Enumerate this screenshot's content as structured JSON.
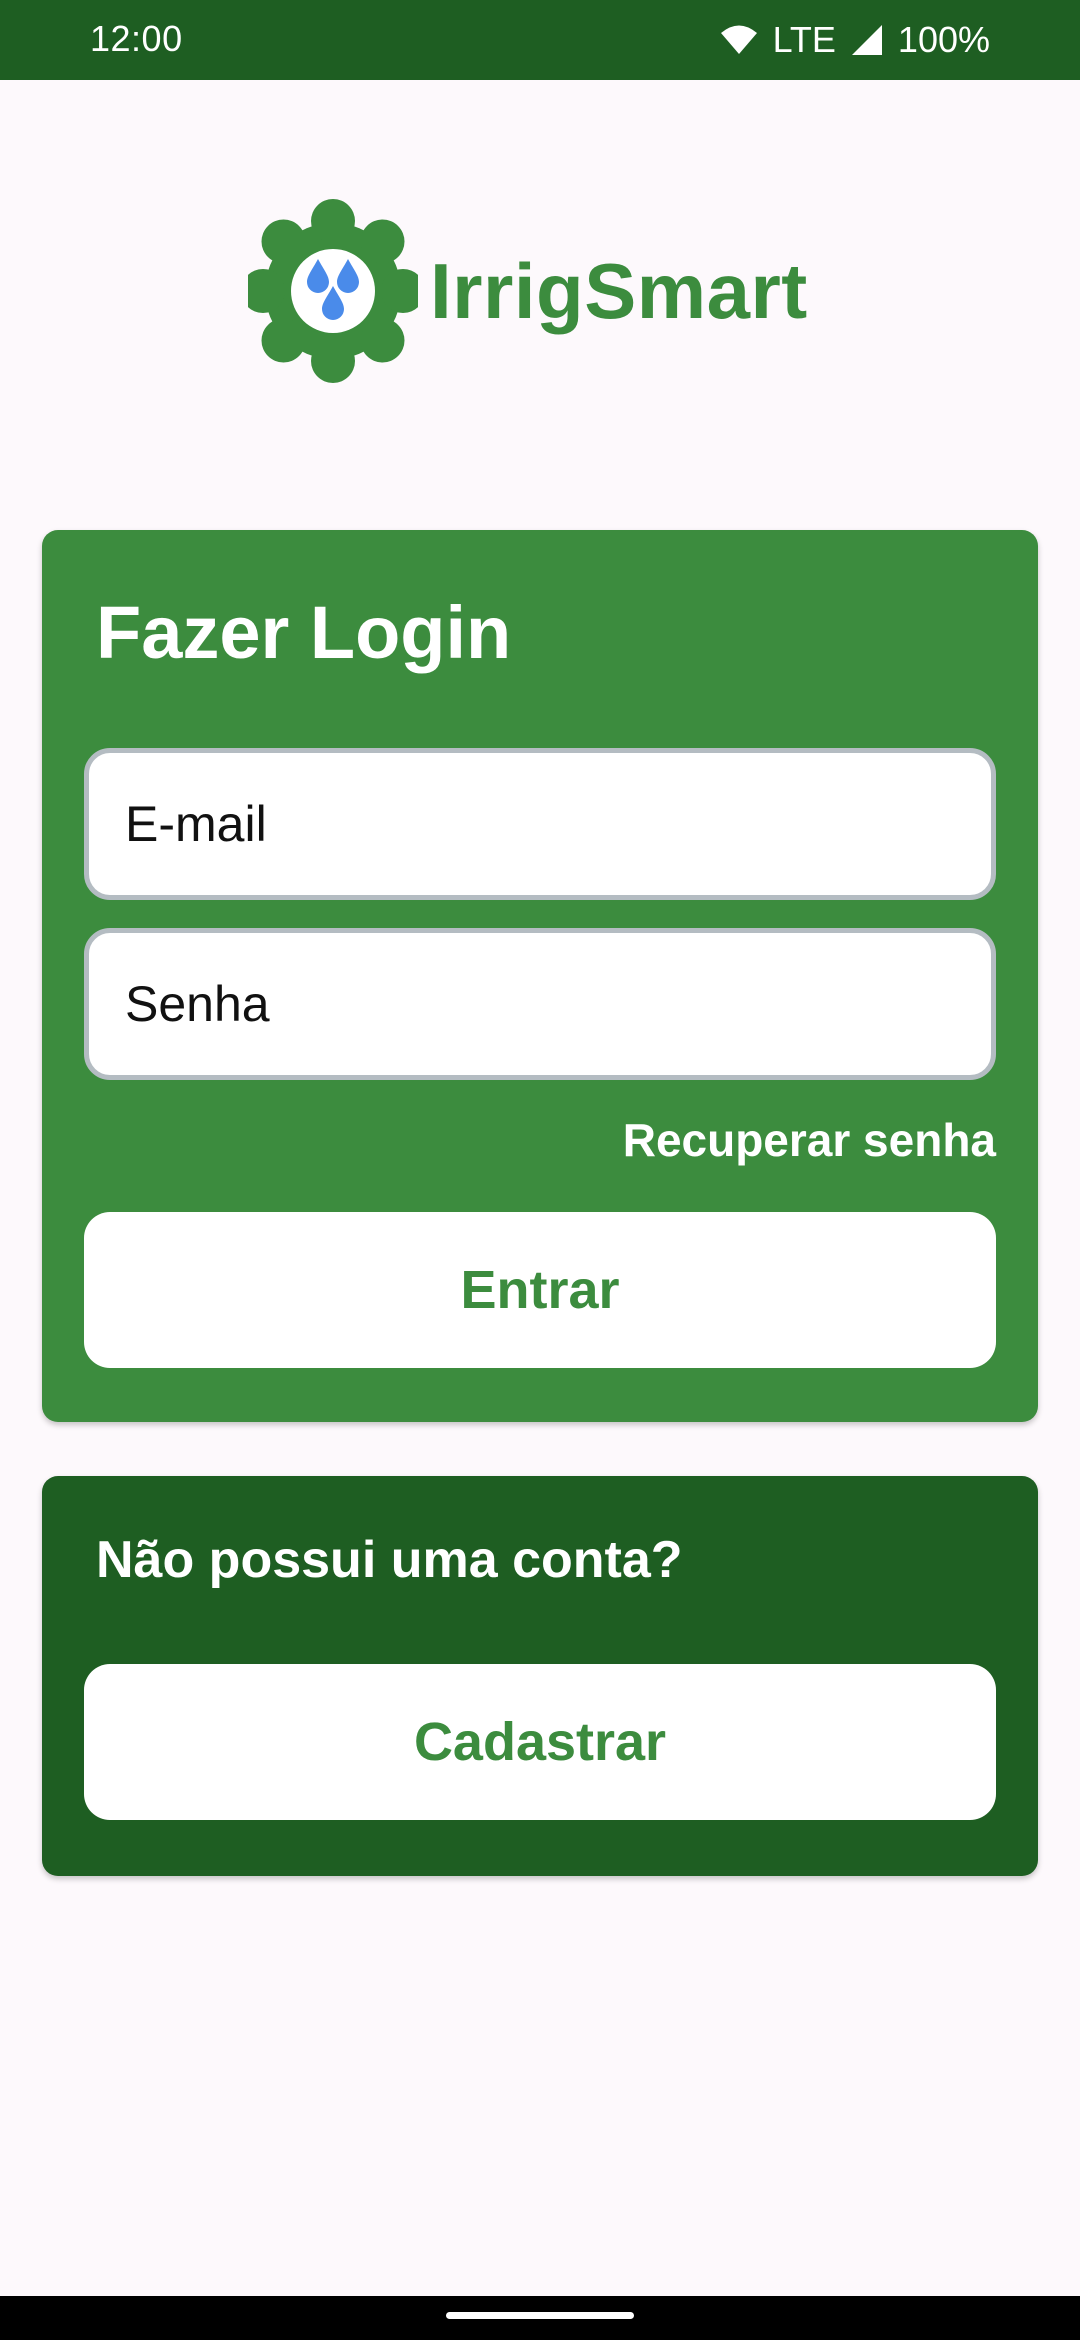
{
  "status_bar": {
    "time": "12:00",
    "network": "LTE",
    "battery": "100%",
    "icons": [
      "wifi-icon",
      "cell-signal-icon"
    ]
  },
  "logo": {
    "brand_name": "IrrigSmart",
    "icon": "gear-water-drops-icon"
  },
  "login": {
    "title": "Fazer Login",
    "email_placeholder": "E-mail",
    "password_placeholder": "Senha",
    "recover_label": "Recuperar senha",
    "submit_label": "Entrar"
  },
  "signup": {
    "question": "Não possui uma conta?",
    "button_label": "Cadastrar"
  },
  "colors": {
    "status_bar": "#1e5e22",
    "primary_green": "#3c8c3e",
    "dark_green": "#1e5e22",
    "drop_blue": "#4a8bea",
    "background": "#fdf9fc"
  }
}
